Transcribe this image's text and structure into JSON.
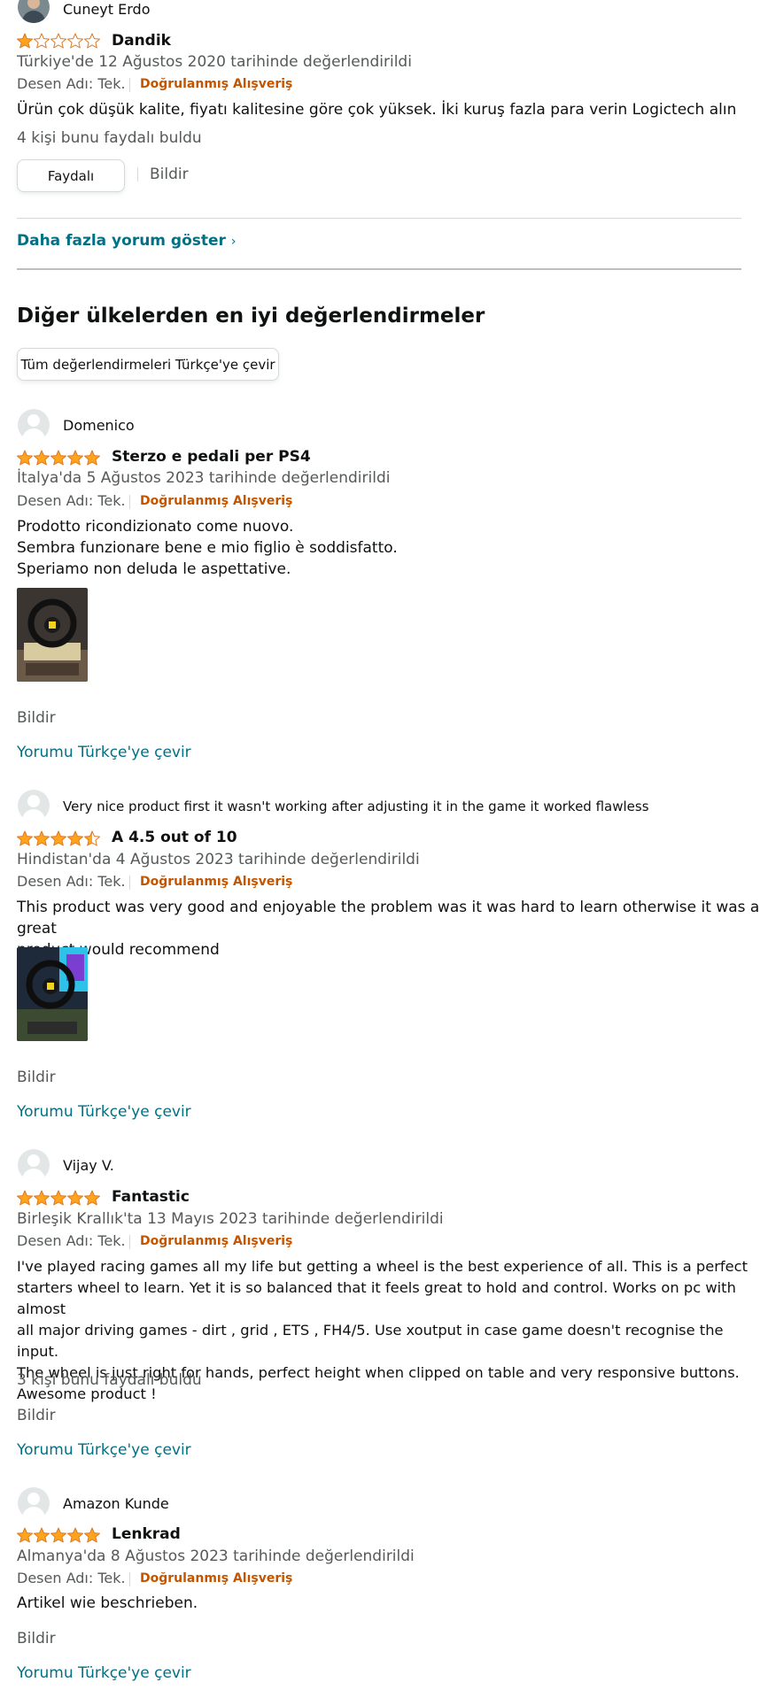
{
  "top_review": {
    "author": "Cuneyt Erdo",
    "rating": 1,
    "title": "Dandik",
    "meta": "Türkiye'de 12 Ağustos 2020 tarihinde değerlendirildi",
    "desen": "Desen Adı: Tek.",
    "verified": "Doğrulanmış Alışveriş",
    "body": "Ürün çok düşük kalite, fiyatı kalitesine göre çok yüksek. İki kuruş fazla para verin Logictech alın",
    "helpful_count": "4 kişi bunu faydalı buldu",
    "helpful_button": "Faydalı",
    "report": "Bildir"
  },
  "more_reviews_link": "Daha fazla yorum göster",
  "more_reviews_chevron": "›",
  "other_countries": {
    "heading": "Diğer ülkelerden en iyi değerlendirmeler",
    "translate_all_button": "Tüm değerlendirmeleri Türkçe'ye çevir"
  },
  "reviews": [
    {
      "author": "Domenico",
      "rating": 5,
      "title": "Sterzo e pedali per PS4",
      "meta": "İtalya'da 5 Ağustos 2023 tarihinde değerlendirildi",
      "desen": "Desen Adı: Tek.",
      "verified": "Doğrulanmış Alışveriş",
      "body": "Prodotto ricondizionato come nuovo.\nSembra funzionare bene e mio figlio è soddisfatto.\nSperiamo non deluda le aspettative.",
      "report": "Bildir",
      "translate": "Yorumu Türkçe'ye çevir"
    },
    {
      "author": "Very nice product first it wasn't working after adjusting it in the game it worked flawless",
      "rating": 4.5,
      "title": "A 4.5 out of 10",
      "meta": "Hindistan'da 4 Ağustos 2023 tarihinde değerlendirildi",
      "desen": "Desen Adı: Tek.",
      "verified": "Doğrulanmış Alışveriş",
      "body": "This product was very good and enjoyable the problem was it was hard to learn otherwise it was a great\nproduct would recommend",
      "report": "Bildir",
      "translate": "Yorumu Türkçe'ye çevir"
    },
    {
      "author": "Vijay V.",
      "rating": 5,
      "title": "Fantastic",
      "meta": "Birleşik Krallık'ta 13 Mayıs 2023 tarihinde değerlendirildi",
      "desen": "Desen Adı: Tek.",
      "verified": "Doğrulanmış Alışveriş",
      "body": "I've played racing games all my life but getting a wheel is the best experience of all. This is a perfect\nstarters wheel to learn. Yet it is so balanced that it feels great to hold and control. Works on pc with almost\nall major driving games - dirt , grid , ETS , FH4/5. Use xoutput in case game doesn't recognise the input.\nThe wheel is just right for hands, perfect height when clipped on table and very responsive buttons.\nAwesome product !",
      "helpful_count": "3 kişi bunu faydalı buldu",
      "report": "Bildir",
      "translate": "Yorumu Türkçe'ye çevir"
    },
    {
      "author": "Amazon Kunde",
      "rating": 5,
      "title": "Lenkrad",
      "meta": "Almanya'da 8 Ağustos 2023 tarihinde değerlendirildi",
      "desen": "Desen Adı: Tek.",
      "verified": "Doğrulanmış Alışveriş",
      "body": "Artikel wie beschrieben.",
      "report": "Bildir",
      "translate": "Yorumu Türkçe'ye çevir"
    }
  ],
  "colors": {
    "star_fill": "#ffa41c",
    "star_stroke": "#de7921",
    "link": "#007185",
    "verified": "#c45500"
  }
}
